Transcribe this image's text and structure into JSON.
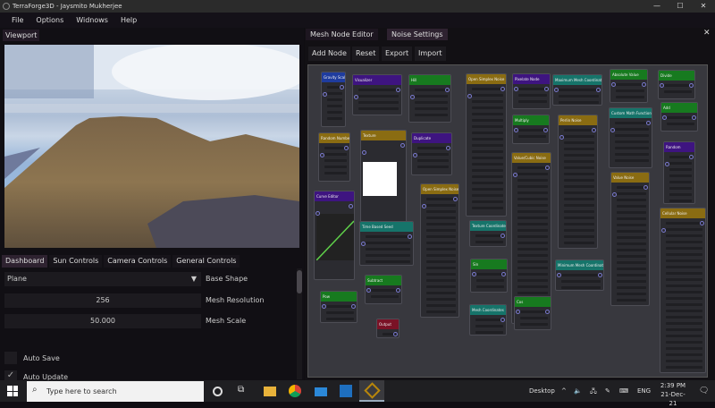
{
  "window": {
    "title": "TerraForge3D - Jaysmito Mukherjee",
    "controls": [
      "—",
      "☐",
      "✕"
    ]
  },
  "menu": [
    "File",
    "Options",
    "Widnows",
    "Help"
  ],
  "viewport": {
    "title": "Viewport"
  },
  "dashboard": {
    "tabs": [
      "Dashboard",
      "Sun Controls",
      "Camera Controls",
      "General Controls"
    ],
    "base_shape": {
      "value": "Plane",
      "label": "Base Shape"
    },
    "mesh_resolution": {
      "value": "256",
      "label": "Mesh Resolution"
    },
    "mesh_scale": {
      "value": "50.000",
      "label": "Mesh Scale"
    },
    "auto_save": {
      "label": "Auto Save",
      "checked": false
    },
    "auto_update": {
      "label": "Auto Update",
      "checked": true
    }
  },
  "editor": {
    "tabs": [
      "Mesh Node Editor",
      "Noise Settings"
    ],
    "close": "✕",
    "toolbar": [
      "Add Node",
      "Reset",
      "Export",
      "Import"
    ],
    "node_colors": {
      "blue": "#1f3c9e",
      "purple": "#3e1480",
      "green": "#177a1f",
      "gold": "#8a6c12",
      "teal": "#16746a",
      "red": "#7a1226"
    },
    "nodes": [
      {
        "title": "Gravity Scale",
        "color": "blue"
      },
      {
        "title": "Visualizer",
        "color": "purple"
      },
      {
        "title": "Hill",
        "color": "green"
      },
      {
        "title": "Open Simplex Noise",
        "color": "gold"
      },
      {
        "title": "Random Number",
        "color": "gold"
      },
      {
        "title": "Texture",
        "color": "gold"
      },
      {
        "title": "Duplicate",
        "color": "purple"
      },
      {
        "title": "Curve Editor",
        "color": "purple"
      },
      {
        "title": "Time Based Seed",
        "color": "teal"
      },
      {
        "title": "Open Simplex Noise",
        "color": "gold"
      },
      {
        "title": "Subtract",
        "color": "green"
      },
      {
        "title": "Pow",
        "color": "green"
      },
      {
        "title": "Output",
        "color": "red"
      },
      {
        "title": "Texture Coordinates",
        "color": "teal"
      },
      {
        "title": "Sin",
        "color": "green"
      },
      {
        "title": "Mesh Coordinates",
        "color": "teal"
      },
      {
        "title": "Pixelate Node",
        "color": "purple"
      },
      {
        "title": "Maximum Mesh Coordinates",
        "color": "teal"
      },
      {
        "title": "Absolute Value",
        "color": "green"
      },
      {
        "title": "Divide",
        "color": "green"
      },
      {
        "title": "Multiply",
        "color": "green"
      },
      {
        "title": "Perlin Noise",
        "color": "gold"
      },
      {
        "title": "Custom Math Function",
        "color": "teal"
      },
      {
        "title": "Add",
        "color": "green"
      },
      {
        "title": "Value/Cubic Noise",
        "color": "gold"
      },
      {
        "title": "Value Noise",
        "color": "gold"
      },
      {
        "title": "Random",
        "color": "purple"
      },
      {
        "title": "Minimum Mesh Coordinates",
        "color": "teal"
      },
      {
        "title": "Cos",
        "color": "green"
      },
      {
        "title": "Cellular Noise",
        "color": "gold"
      }
    ]
  },
  "taskbar": {
    "search_placeholder": "Type here to search",
    "desktop": "Desktop",
    "lang": "ENG",
    "time": "2:39 PM",
    "date": "21-Dec-21"
  }
}
